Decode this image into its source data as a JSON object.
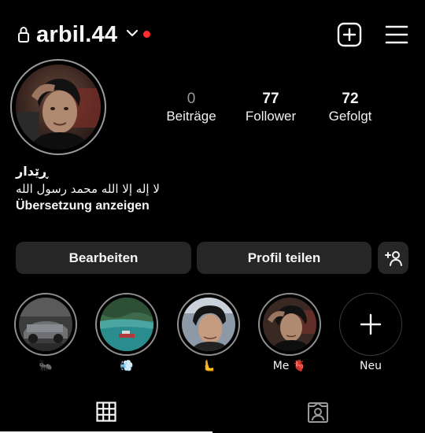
{
  "header": {
    "username": "arbil.44",
    "lock_icon": "lock-icon",
    "dropdown_icon": "chevron-down-icon",
    "notification_dot_color": "#ff2d2d",
    "create_icon": "plus-square-icon",
    "menu_icon": "hamburger-menu-icon"
  },
  "profile": {
    "avatar_icon": "avatar",
    "stats": {
      "posts": {
        "value": "0",
        "label": "Beiträge"
      },
      "followers": {
        "value": "77",
        "label": "Follower"
      },
      "following": {
        "value": "72",
        "label": "Gefolgt"
      }
    },
    "bio": {
      "name": "ڕێدار",
      "text": "لا إله إلا الله محمد رسول الله",
      "translate_link": "Übersetzung anzeigen"
    }
  },
  "actions": {
    "edit_label": "Bearbeiten",
    "share_label": "Profil teilen",
    "add_person_icon": "add-person-icon"
  },
  "highlights": [
    {
      "label": "🐜"
    },
    {
      "label": "💨"
    },
    {
      "label": "🫷"
    },
    {
      "label": "Me 🫀"
    },
    {
      "label": "Neu"
    }
  ],
  "tabs": {
    "grid_icon": "grid-icon",
    "tagged_icon": "tagged-icon",
    "active": "grid"
  },
  "colors": {
    "background": "#000000",
    "button_bg": "#262626",
    "text": "#f5f5f5",
    "muted": "#9a9a9a"
  }
}
